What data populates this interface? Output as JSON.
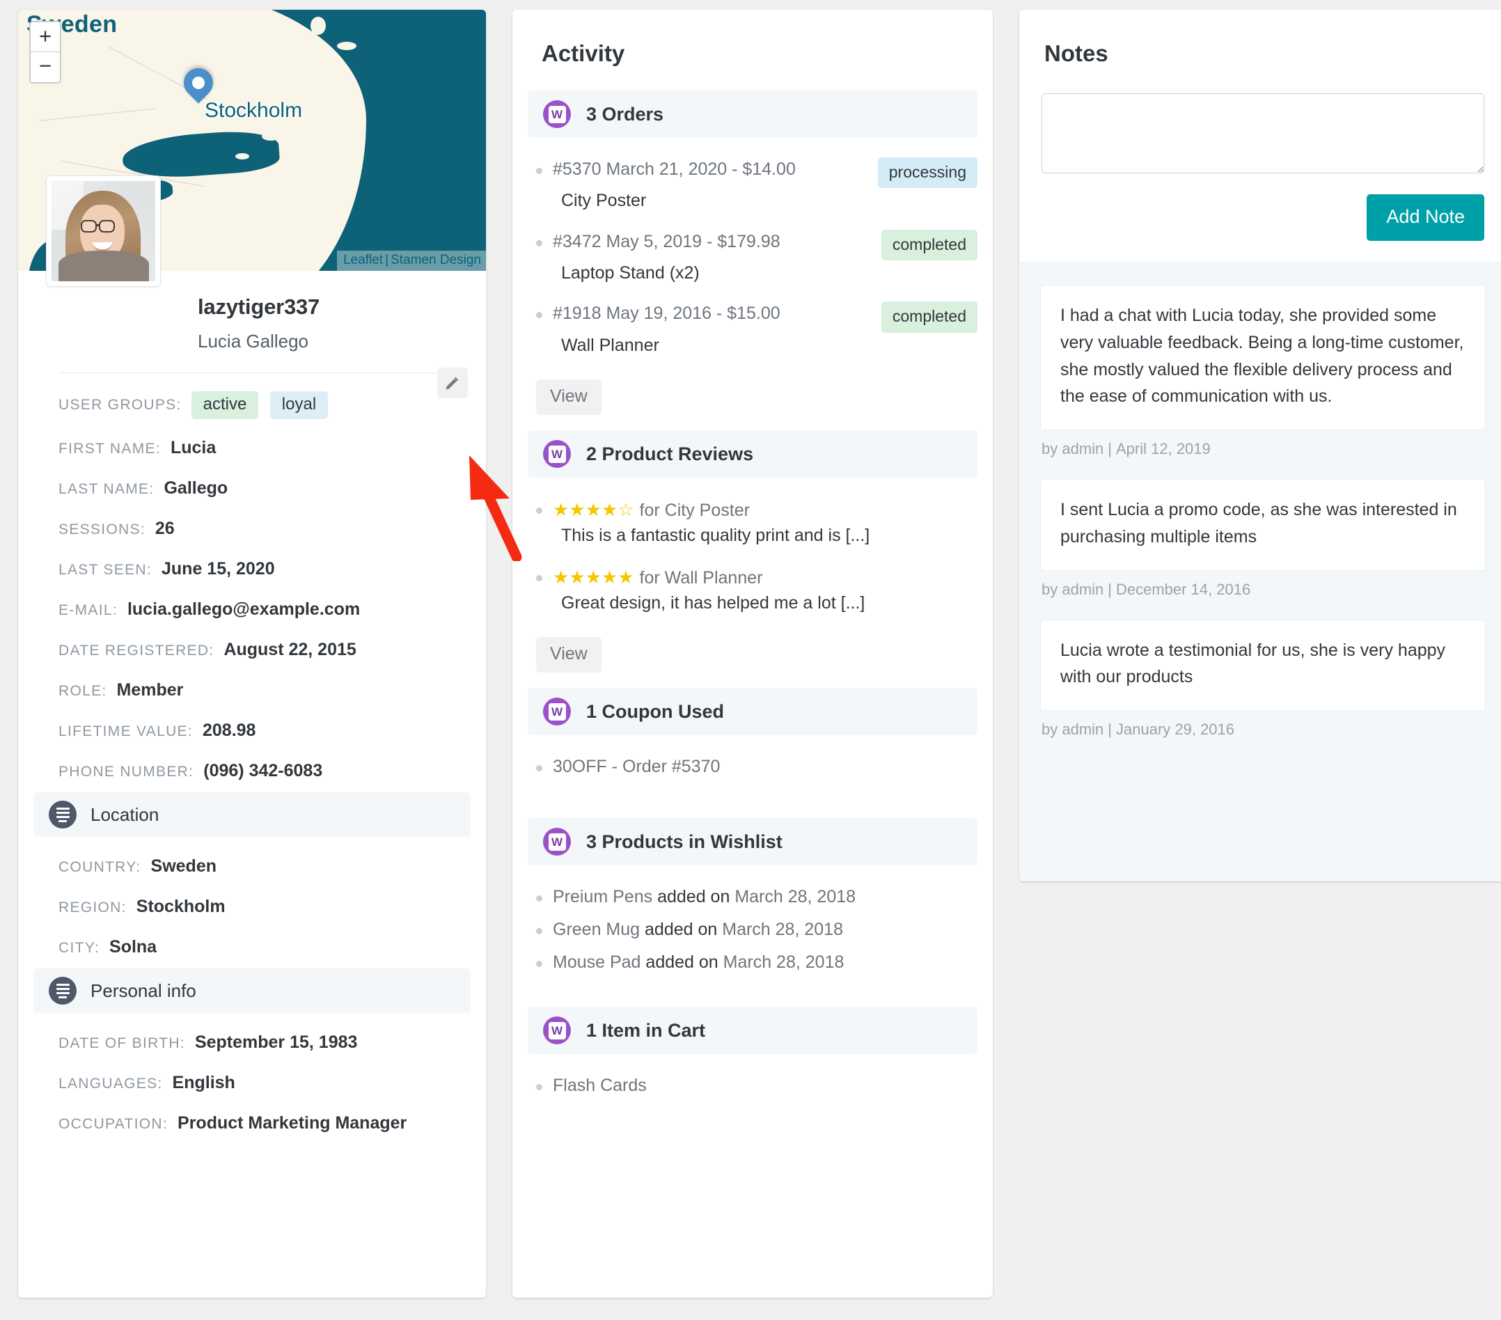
{
  "profile": {
    "map": {
      "country_label": "Sweden",
      "city_label": "Stockholm",
      "zoom_in": "+",
      "zoom_out": "−",
      "attribution_leaflet": "Leaflet",
      "attribution_sep": "|",
      "attribution_stamen": "Stamen Design"
    },
    "username": "lazytiger337",
    "fullname": "Lucia Gallego",
    "edit_icon": "pencil-icon",
    "fields": [
      {
        "label": "USER GROUPS:",
        "tags": [
          "active",
          "loyal"
        ]
      },
      {
        "label": "FIRST NAME:",
        "value": "Lucia"
      },
      {
        "label": "LAST NAME:",
        "value": "Gallego"
      },
      {
        "label": "SESSIONS:",
        "value": "26"
      },
      {
        "label": "LAST SEEN:",
        "value": "June 15, 2020"
      },
      {
        "label": "E-MAIL:",
        "value": "lucia.gallego@example.com"
      },
      {
        "label": "DATE REGISTERED:",
        "value": "August 22, 2015"
      },
      {
        "label": "ROLE:",
        "value": "Member"
      },
      {
        "label": "LIFETIME VALUE:",
        "value": "208.98"
      },
      {
        "label": "PHONE NUMBER:",
        "value": "(096) 342-6083"
      }
    ],
    "location_section": {
      "title": "Location",
      "fields": [
        {
          "label": "COUNTRY:",
          "value": "Sweden"
        },
        {
          "label": "REGION:",
          "value": "Stockholm"
        },
        {
          "label": "CITY:",
          "value": "Solna"
        }
      ]
    },
    "personal_section": {
      "title": "Personal info",
      "fields": [
        {
          "label": "DATE OF BIRTH:",
          "value": "September 15, 1983"
        },
        {
          "label": "LANGUAGES:",
          "value": "English"
        },
        {
          "label": "OCCUPATION:",
          "value": "Product Marketing Manager"
        }
      ]
    }
  },
  "activity": {
    "title": "Activity",
    "view_label": "View",
    "orders": {
      "heading": "3 Orders",
      "items": [
        {
          "line1": "#5370 March 21, 2020 - $14.00",
          "status": "processing",
          "status_type": "processing",
          "line2": "City Poster"
        },
        {
          "line1": "#3472 May 5, 2019 - $179.98",
          "status": "completed",
          "status_type": "completed",
          "line2": "Laptop Stand (x2)"
        },
        {
          "line1": "#1918 May 19, 2016 - $15.00",
          "status": "completed",
          "status_type": "completed",
          "line2": "Wall Planner"
        }
      ]
    },
    "reviews": {
      "heading": "2 Product Reviews",
      "items": [
        {
          "stars_filled": 4,
          "stars_total": 5,
          "for_text": "for City Poster",
          "text": "This is a fantastic quality print and is [...]"
        },
        {
          "stars_filled": 5,
          "stars_total": 5,
          "for_text": "for Wall Planner",
          "text": "Great design, it has helped me a lot [...]"
        }
      ]
    },
    "coupons": {
      "heading": "1 Coupon Used",
      "items": [
        {
          "text": "30OFF - Order #5370"
        }
      ]
    },
    "wishlist": {
      "heading": "3 Products in Wishlist",
      "items": [
        {
          "name": "Preium Pens",
          "added": "added on",
          "date": "March 28, 2018"
        },
        {
          "name": "Green Mug",
          "added": "added on",
          "date": "March 28, 2018"
        },
        {
          "name": "Mouse Pad",
          "added": "added on",
          "date": "March 28, 2018"
        }
      ]
    },
    "cart": {
      "heading": "1 Item in Cart",
      "items": [
        {
          "text": "Flash Cards"
        }
      ]
    }
  },
  "notes": {
    "title": "Notes",
    "new_note_value": "",
    "new_note_placeholder": "",
    "add_button": "Add Note",
    "accent_color": "#00a0a8",
    "items": [
      {
        "body": "I had a chat with Lucia today, she provided some very valuable feedback. Being a long-time customer, she mostly valued the flexible delivery process and the ease of communication with us.",
        "author": "by admin",
        "sep": "|",
        "date": "April 12, 2019"
      },
      {
        "body": "I sent Lucia a promo code, as she was interested in purchasing multiple items",
        "author": "by admin",
        "sep": "|",
        "date": "December 14, 2016"
      },
      {
        "body": "Lucia wrote a testimonial for us, she is very happy with our products",
        "author": "by admin",
        "sep": "|",
        "date": "January 29, 2016"
      }
    ]
  },
  "annotation": {
    "arrow_color": "#f42b12",
    "points_at": "edit-profile-button"
  }
}
